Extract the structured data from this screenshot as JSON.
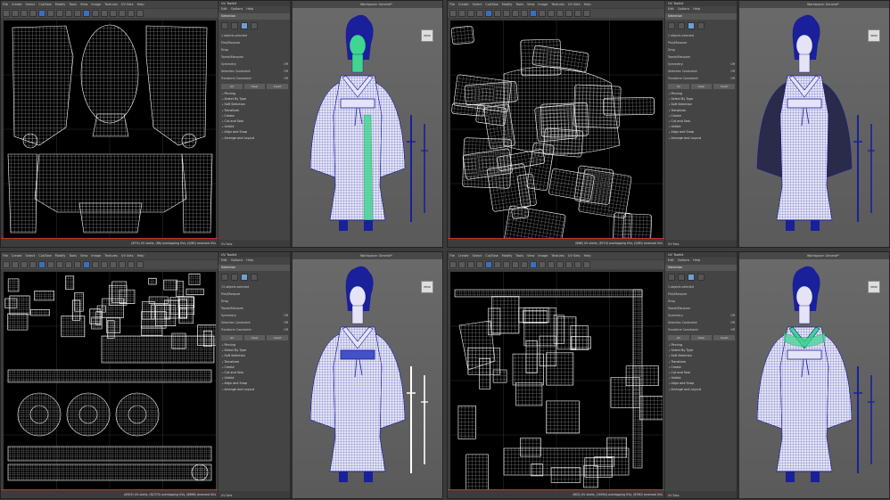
{
  "windows": [
    {
      "uv_title": "UV Editor",
      "uv_menu": [
        "File",
        "Create",
        "Select",
        "Cut/Sew",
        "Modify",
        "Tools",
        "View",
        "Image",
        "Textures",
        "UV Sets",
        "Help"
      ],
      "uv_status": "(87%) UV shells, (86) overlapping UVs, (0/80) reversed UVs",
      "tk_title": "UV Toolkit",
      "tk_menu": [
        "Edit",
        "Options",
        "Help"
      ],
      "workspace_label": "Workspace:",
      "workspace_value": "General*",
      "selection_header": "Selection",
      "objects_selected": "1 objects selected",
      "pick_marquee": "Pick/Marquee",
      "drag": "Drag",
      "tweak_marquee": "Tweak/Marquee",
      "symmetry": "Symmetry:",
      "symmetry_value": "Off",
      "selection_constraint": "Selection Constraint:",
      "transform_constraint": "Transform Constraint:",
      "constraint_value": "Off",
      "btn_all": "All",
      "btn_clear": "Clear",
      "btn_invert": "Invert",
      "sections": [
        "Pinning",
        "Select By Type",
        "Soft Selection",
        "Transform",
        "Create",
        "Cut and Sew",
        "Unfold",
        "Align and Snap",
        "Arrange and Layout"
      ],
      "uv_sets": "UV Sets",
      "persp": "PERSP",
      "selected_region": "body"
    },
    {
      "uv_title": "UV Editor",
      "uv_menu": [
        "File",
        "Create",
        "Select",
        "Cut/Sew",
        "Modify",
        "Tools",
        "View",
        "Image",
        "Textures",
        "UV Sets",
        "Help"
      ],
      "uv_status": "(888) UV shells, (8719) overlapping UVs, (0/80) reversed UVs",
      "tk_title": "UV Toolkit",
      "tk_menu": [
        "Edit",
        "Options",
        "Help"
      ],
      "workspace_label": "Workspace:",
      "workspace_value": "General*",
      "selection_header": "Selection",
      "objects_selected": "1 objects selected",
      "pick_marquee": "Pick/Marquee",
      "drag": "Drag",
      "tweak_marquee": "Tweak/Marquee",
      "symmetry": "Symmetry:",
      "symmetry_value": "Off",
      "selection_constraint": "Selection Constraint:",
      "transform_constraint": "Transform Constraint:",
      "constraint_value": "Off",
      "btn_all": "All",
      "btn_clear": "Clear",
      "btn_invert": "Invert",
      "sections": [
        "Pinning",
        "Select By Type",
        "Soft Selection",
        "Transform",
        "Create",
        "Cut and Sew",
        "Unfold",
        "Align and Snap",
        "Arrange and Layout"
      ],
      "uv_sets": "UV Sets",
      "persp": "PERSP",
      "selected_region": "robe"
    },
    {
      "uv_title": "UV Editor",
      "uv_menu": [
        "File",
        "Create",
        "Select",
        "Cut/Sew",
        "Modify",
        "Tools",
        "View",
        "Image",
        "Textures",
        "UV Sets",
        "Help"
      ],
      "uv_status": "(8903) UV shells, (82370) overlapping UVs, (8896) reversed UVs",
      "tk_title": "UV Toolkit",
      "tk_menu": [
        "Edit",
        "Options",
        "Help"
      ],
      "workspace_label": "Workspace:",
      "workspace_value": "General*",
      "selection_header": "Selection",
      "objects_selected": "74 objects selected",
      "pick_marquee": "Pick/Marquee",
      "drag": "Drag",
      "tweak_marquee": "Tweak/Marquee",
      "symmetry": "Symmetry:",
      "symmetry_value": "Off",
      "selection_constraint": "Selection Constraint:",
      "transform_constraint": "Transform Constraint:",
      "constraint_value": "Off",
      "btn_all": "All",
      "btn_clear": "Clear",
      "btn_invert": "Invert",
      "sections": [
        "Pinning",
        "Select By Type",
        "Soft Selection",
        "Transform",
        "Create",
        "Cut and Sew",
        "Unfold",
        "Align and Snap",
        "Arrange and Layout"
      ],
      "uv_sets": "UV Sets",
      "persp": "PERSP",
      "selected_region": "accessories"
    },
    {
      "uv_title": "UV Editor",
      "uv_menu": [
        "File",
        "Create",
        "Select",
        "Cut/Sew",
        "Modify",
        "Tools",
        "View",
        "Image",
        "Textures",
        "UV Sets",
        "Help"
      ],
      "uv_status": "(803) UV shells, (16994) overlapping UVs, (8760) reversed UVs",
      "tk_title": "UV Toolkit",
      "tk_menu": [
        "Edit",
        "Options",
        "Help"
      ],
      "workspace_label": "Workspace:",
      "workspace_value": "General*",
      "selection_header": "Selection",
      "objects_selected": "1 objects selected",
      "pick_marquee": "Pick/Marquee",
      "drag": "Drag",
      "tweak_marquee": "Tweak/Marquee",
      "symmetry": "Symmetry:",
      "symmetry_value": "Off",
      "selection_constraint": "Selection Constraint:",
      "transform_constraint": "Transform Constraint:",
      "constraint_value": "Off",
      "btn_all": "All",
      "btn_clear": "Clear",
      "btn_invert": "Invert",
      "sections": [
        "Pinning",
        "Select By Type",
        "Soft Selection",
        "Transform",
        "Create",
        "Cut and Sew",
        "Unfold",
        "Align and Snap",
        "Arrange and Layout"
      ],
      "uv_sets": "UV Sets",
      "persp": "PERSP",
      "selected_region": "collar"
    }
  ],
  "colors": {
    "wire": "#ffffff",
    "uv_bg": "#000000",
    "selection_green": "#3fd68f",
    "model_blue": "#1a1f9a",
    "model_fill": "#e4e4f6"
  }
}
